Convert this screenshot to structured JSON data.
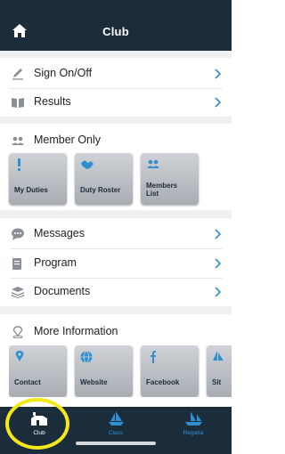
{
  "header": {
    "title": "Club"
  },
  "menu1": [
    {
      "label": "Sign On/Off",
      "icon": "pencil-icon"
    },
    {
      "label": "Results",
      "icon": "book-icon"
    }
  ],
  "member": {
    "heading": "Member Only",
    "tiles": [
      {
        "label": "My Duties",
        "icon": "exclamation-icon"
      },
      {
        "label": "Duty Roster",
        "icon": "handshake-icon"
      },
      {
        "label": "Members List",
        "icon": "people-icon"
      }
    ]
  },
  "menu2": [
    {
      "label": "Messages",
      "icon": "chat-bubble-icon"
    },
    {
      "label": "Program",
      "icon": "calendar-icon"
    },
    {
      "label": "Documents",
      "icon": "layers-icon"
    }
  ],
  "more": {
    "heading": "More Information",
    "tiles": [
      {
        "label": "Contact",
        "icon": "location-pin-icon"
      },
      {
        "label": "Website",
        "icon": "globe-icon"
      },
      {
        "label": "Facebook",
        "icon": "facebook-icon"
      },
      {
        "label": "Sit",
        "icon": "sail-icon"
      }
    ]
  },
  "tabbar": {
    "tabs": [
      {
        "label": "Club",
        "active": true
      },
      {
        "label": "Class",
        "active": false
      },
      {
        "label": "Regatta",
        "active": false
      }
    ]
  },
  "colors": {
    "header": "#1b2d3b",
    "accent": "#2f8fd0",
    "highlight": "#f4e81a",
    "tile_label": "#1d2a36"
  }
}
